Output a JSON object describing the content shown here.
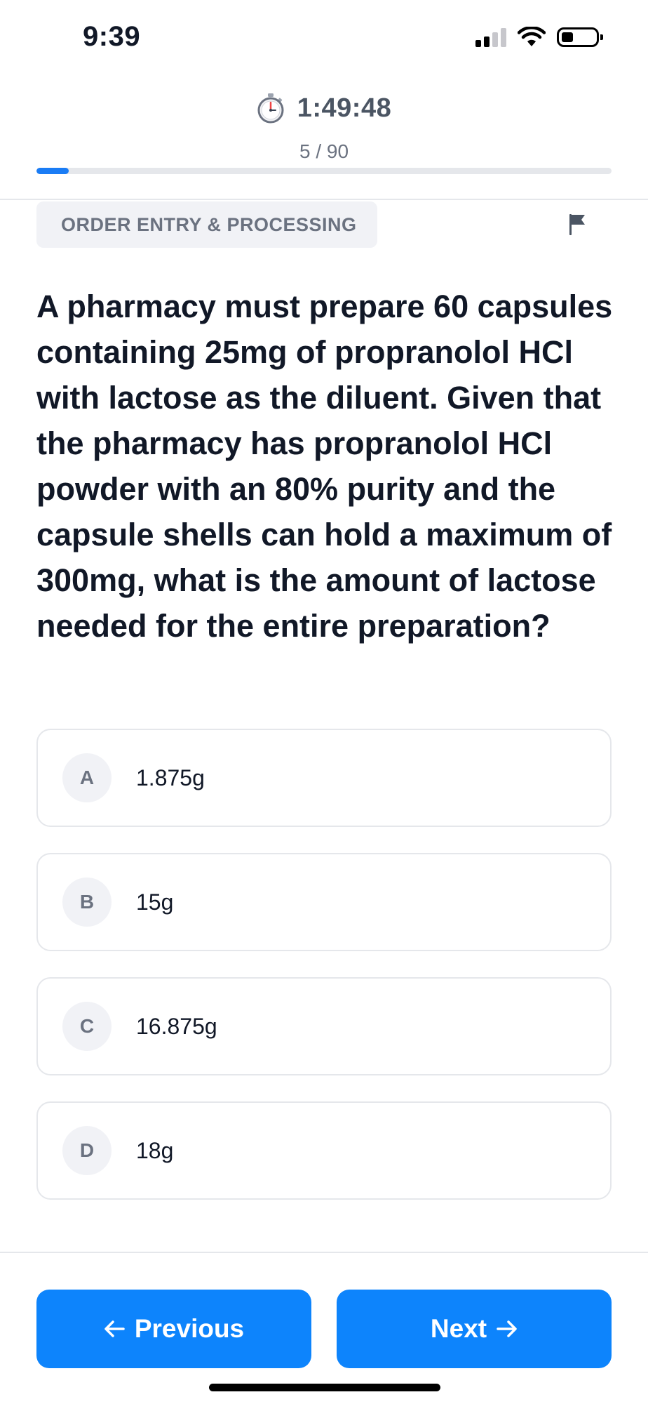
{
  "status_bar": {
    "time": "9:39",
    "icons": [
      "cellular-signal-icon",
      "wifi-icon",
      "battery-icon"
    ]
  },
  "header": {
    "timer_icon": "stopwatch-icon",
    "timer": "1:49:48",
    "counter": "5 / 90",
    "progress": 0.056
  },
  "category": {
    "label": "ORDER ENTRY & PROCESSING",
    "flag_icon": "flag-icon"
  },
  "question": {
    "text": "A pharmacy must prepare 60 capsules containing 25mg of propranolol HCl with lactose as the diluent. Given that the pharmacy has propranolol HCl powder with an 80% purity and the capsule shells can hold a maximum of 300mg, what is the amount of lactose needed for the entire preparation?"
  },
  "options": [
    {
      "letter": "A",
      "text": "1.875g"
    },
    {
      "letter": "B",
      "text": "15g"
    },
    {
      "letter": "C",
      "text": "16.875g"
    },
    {
      "letter": "D",
      "text": "18g"
    }
  ],
  "navigation": {
    "previous_label": "Previous",
    "next_label": "Next",
    "previous_icon": "arrow-left-icon",
    "next_icon": "arrow-right-icon"
  },
  "colors": {
    "accent": "#0d84fc",
    "progress": "#1a7cf5"
  }
}
